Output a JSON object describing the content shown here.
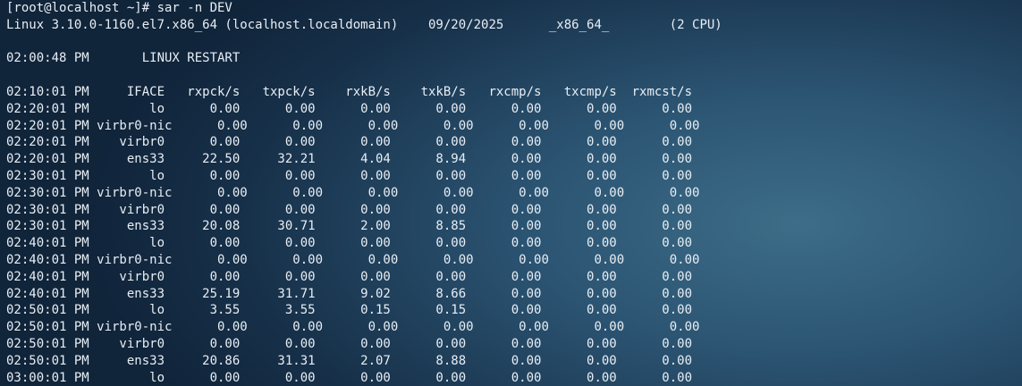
{
  "terminal": {
    "prompt_line": "[root@localhost ~]# sar -n DEV",
    "system_info": "Linux 3.10.0-1160.el7.x86_64 (localhost.localdomain)    09/20/2025      _x86_64_        (2 CPU)",
    "restart_line": "02:00:48 PM       LINUX RESTART",
    "header_line": "02:10:01 PM     IFACE   rxpck/s   txpck/s    rxkB/s    txkB/s   rxcmp/s   txcmp/s  rxmcst/s",
    "rows": [
      "02:20:01 PM        lo      0.00      0.00      0.00      0.00      0.00      0.00      0.00",
      "02:20:01 PM virbr0-nic      0.00      0.00      0.00      0.00      0.00      0.00      0.00",
      "02:20:01 PM    virbr0      0.00      0.00      0.00      0.00      0.00      0.00      0.00",
      "02:20:01 PM     ens33     22.50     32.21      4.04      8.94      0.00      0.00      0.00",
      "02:30:01 PM        lo      0.00      0.00      0.00      0.00      0.00      0.00      0.00",
      "02:30:01 PM virbr0-nic      0.00      0.00      0.00      0.00      0.00      0.00      0.00",
      "02:30:01 PM    virbr0      0.00      0.00      0.00      0.00      0.00      0.00      0.00",
      "02:30:01 PM     ens33     20.08     30.71      2.00      8.85      0.00      0.00      0.00",
      "02:40:01 PM        lo      0.00      0.00      0.00      0.00      0.00      0.00      0.00",
      "02:40:01 PM virbr0-nic      0.00      0.00      0.00      0.00      0.00      0.00      0.00",
      "02:40:01 PM    virbr0      0.00      0.00      0.00      0.00      0.00      0.00      0.00",
      "02:40:01 PM     ens33     25.19     31.71      9.02      8.66      0.00      0.00      0.00",
      "02:50:01 PM        lo      3.55      3.55      0.15      0.15      0.00      0.00      0.00",
      "02:50:01 PM virbr0-nic      0.00      0.00      0.00      0.00      0.00      0.00      0.00",
      "02:50:01 PM    virbr0      0.00      0.00      0.00      0.00      0.00      0.00      0.00",
      "02:50:01 PM     ens33     20.86     31.31      2.07      8.88      0.00      0.00      0.00",
      "03:00:01 PM        lo      0.00      0.00      0.00      0.00      0.00      0.00      0.00"
    ]
  },
  "colors": {
    "text": "#e8eef4",
    "background_dark": "#10243a",
    "background_light": "#3d6d88"
  }
}
